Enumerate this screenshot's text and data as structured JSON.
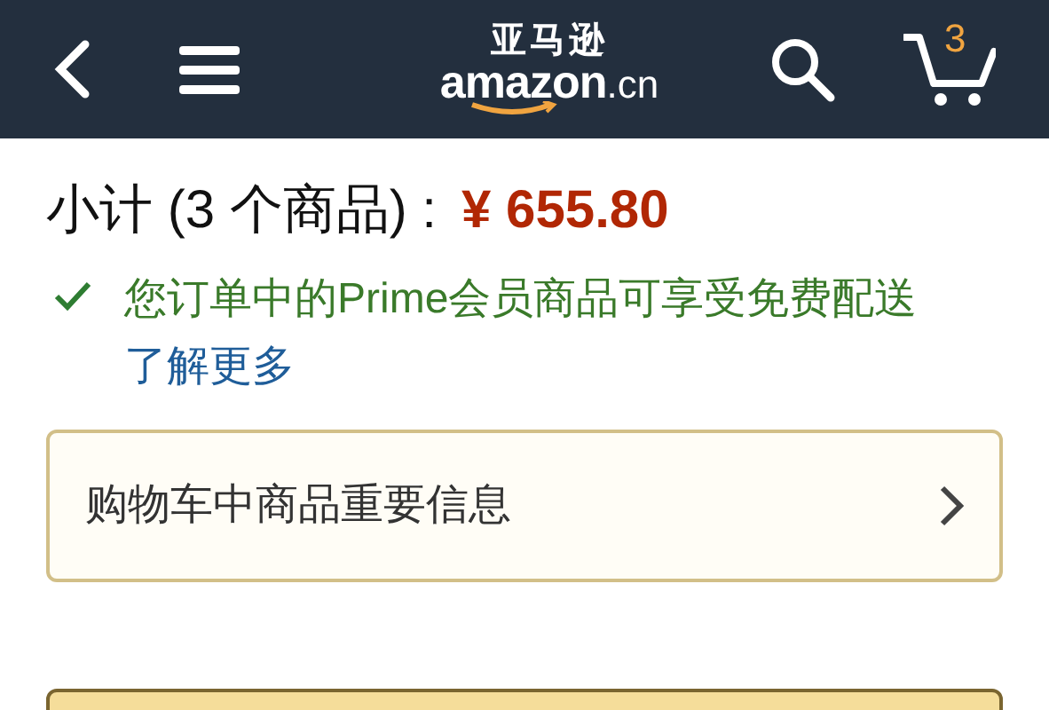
{
  "header": {
    "logo_cn": "亚马逊",
    "logo_main": "amazon",
    "logo_suffix": ".cn",
    "cart_count": "3"
  },
  "subtotal": {
    "label": "小计 (3 个商品) :",
    "price": "¥ 655.80"
  },
  "prime_notice": {
    "text": "您订单中的Prime会员商品可享受免费配送",
    "link": "了解更多"
  },
  "info_card": {
    "label": "购物车中商品重要信息"
  }
}
